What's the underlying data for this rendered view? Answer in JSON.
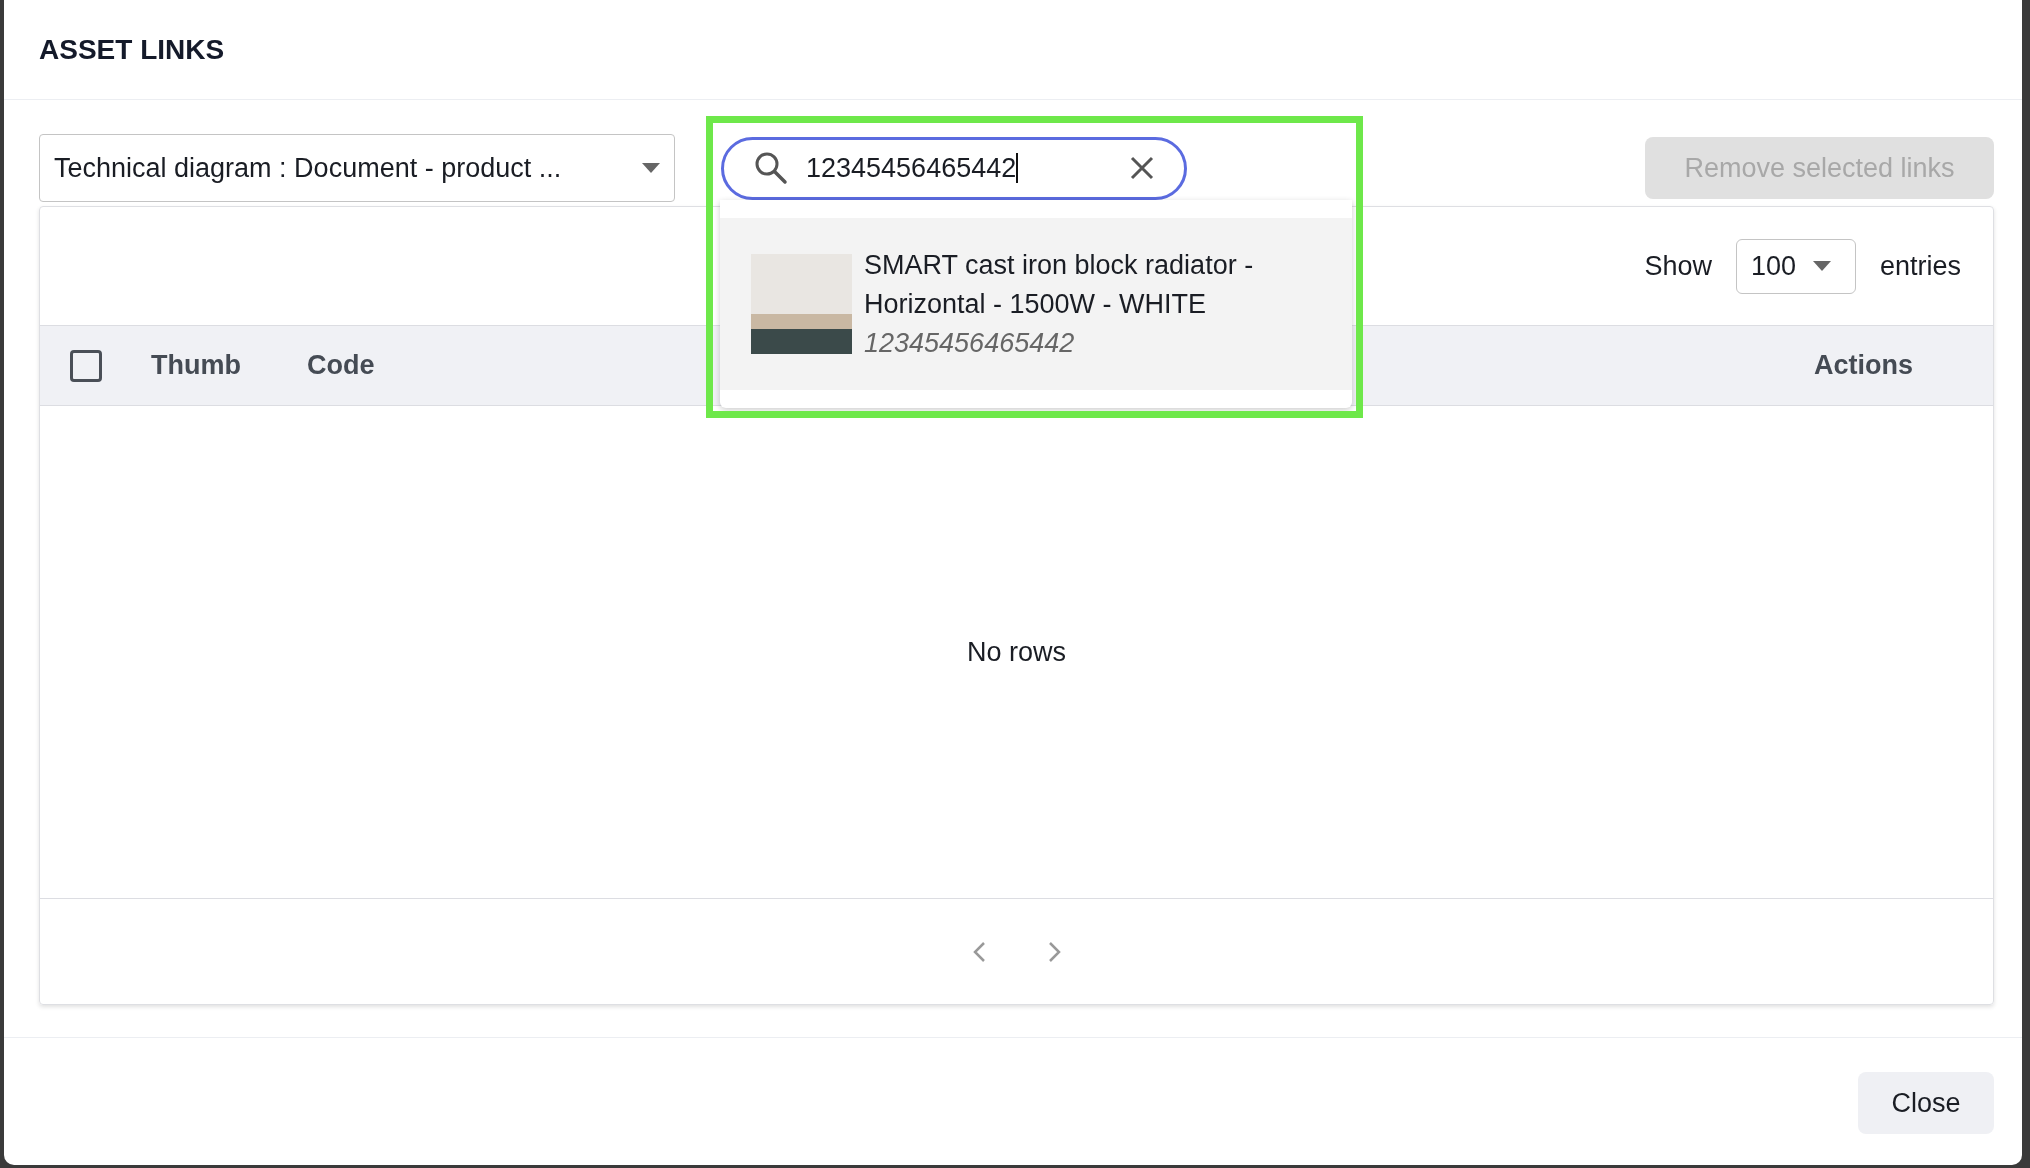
{
  "modal": {
    "title": "ASSET LINKS"
  },
  "type_select": {
    "value": "Technical diagram : Document - product ..."
  },
  "search": {
    "value": "12345456465442",
    "focused": true
  },
  "suggestions": [
    {
      "name": "SMART cast iron block radiator - Horizontal - 1500W - WHITE",
      "code": "12345456465442",
      "selected": true
    }
  ],
  "remove_button": {
    "label": "Remove selected links",
    "disabled": true
  },
  "table": {
    "show_label": "Show",
    "page_size": "100",
    "entries_label": "entries",
    "select_all_checked": false,
    "columns": [
      "Thumb",
      "Code"
    ],
    "actions_column": "Actions",
    "empty_message": "No rows"
  },
  "footer": {
    "close_button": "Close"
  }
}
